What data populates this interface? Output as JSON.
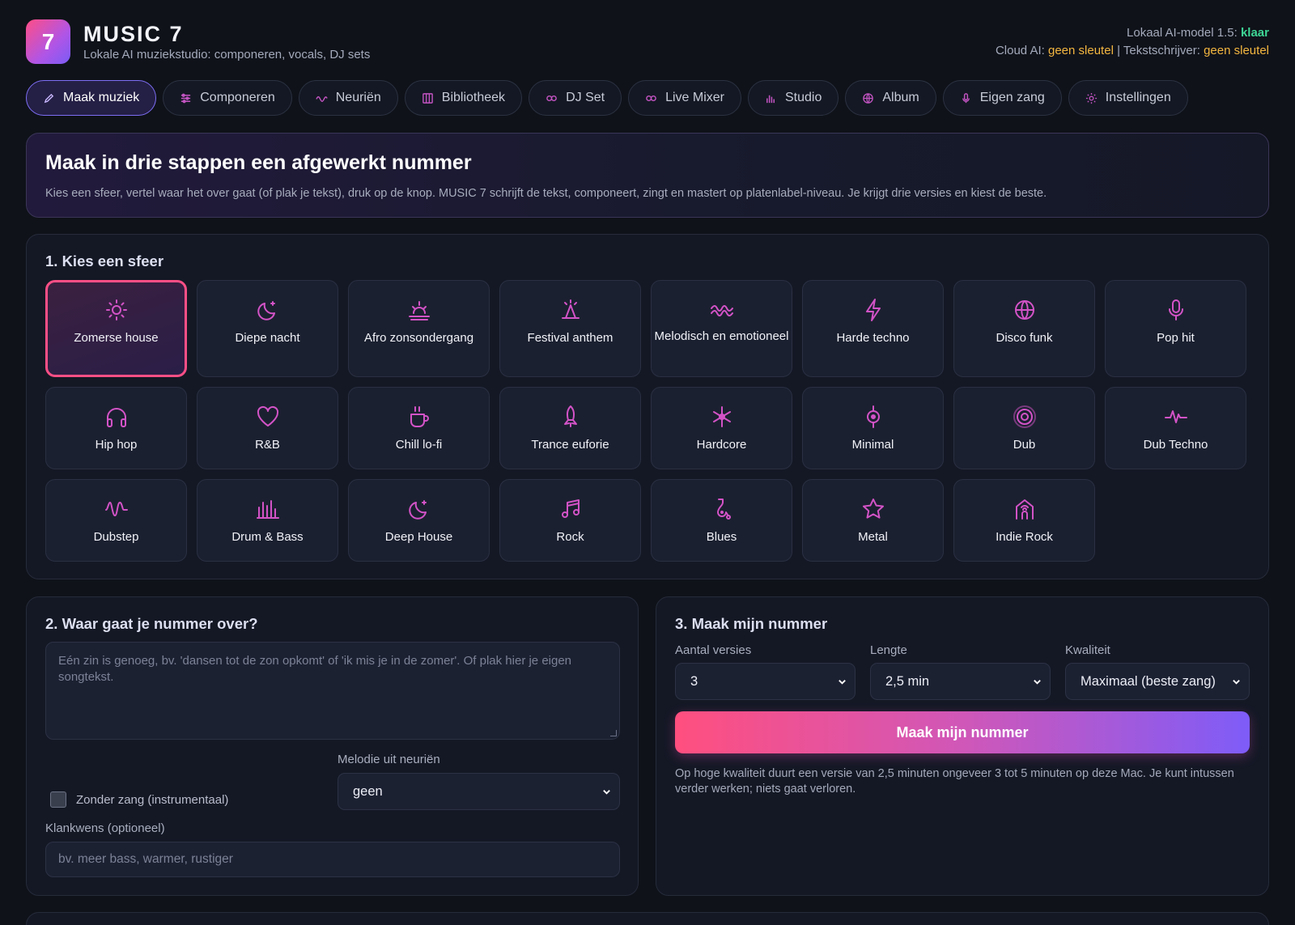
{
  "app": {
    "logo_text": "7",
    "title": "MUSIC 7",
    "subtitle": "Lokale AI muziekstudio: componeren, vocals, DJ sets"
  },
  "status": {
    "local_label": "Lokaal AI-model 1.5:",
    "local_value": "klaar",
    "cloud_label": "Cloud AI:",
    "cloud_value": "geen sleutel",
    "separator": "|",
    "writer_label": "Tekstschrijver:",
    "writer_value": "geen sleutel",
    "ok_color": "#3ed695",
    "warn_color": "#f4b740"
  },
  "tabs": [
    {
      "label": "Maak muziek",
      "icon": "pencil-icon",
      "active": true
    },
    {
      "label": "Componeren",
      "icon": "sliders-icon",
      "active": false
    },
    {
      "label": "Neuriën",
      "icon": "wave-icon",
      "active": false
    },
    {
      "label": "Bibliotheek",
      "icon": "library-icon",
      "active": false
    },
    {
      "label": "DJ Set",
      "icon": "link-icon",
      "active": false
    },
    {
      "label": "Live Mixer",
      "icon": "link-icon",
      "active": false
    },
    {
      "label": "Studio",
      "icon": "bars-icon",
      "active": false
    },
    {
      "label": "Album",
      "icon": "globe-icon",
      "active": false
    },
    {
      "label": "Eigen zang",
      "icon": "mic-icon",
      "active": false
    },
    {
      "label": "Instellingen",
      "icon": "gear-icon",
      "active": false
    }
  ],
  "intro": {
    "title": "Maak in drie stappen een afgewerkt nummer",
    "text": "Kies een sfeer, vertel waar het over gaat (of plak je tekst), druk op de knop. MUSIC 7 schrijft de tekst, componeert, zingt en mastert op platenlabel-niveau. Je krijgt drie versies en kiest de beste."
  },
  "moods": {
    "heading": "1. Kies een sfeer",
    "accent": "#d353c7",
    "selected_border": "#ff4f86",
    "items": [
      {
        "label": "Zomerse house",
        "icon": "sun-icon",
        "selected": true
      },
      {
        "label": "Diepe nacht",
        "icon": "moon-icon",
        "selected": false
      },
      {
        "label": "Afro zonsondergang",
        "icon": "sunset-icon",
        "selected": false
      },
      {
        "label": "Festival anthem",
        "icon": "festival-icon",
        "selected": false
      },
      {
        "label": "Melodisch en emotioneel",
        "icon": "waves-icon",
        "selected": false
      },
      {
        "label": "Harde techno",
        "icon": "bolt-icon",
        "selected": false
      },
      {
        "label": "Disco funk",
        "icon": "globe-icon",
        "selected": false
      },
      {
        "label": "Pop hit",
        "icon": "microphone-icon",
        "selected": false
      },
      {
        "label": "Hip hop",
        "icon": "headphones-icon",
        "selected": false
      },
      {
        "label": "R&B",
        "icon": "heart-icon",
        "selected": false
      },
      {
        "label": "Chill lo-fi",
        "icon": "coffee-icon",
        "selected": false
      },
      {
        "label": "Trance euforie",
        "icon": "rocket-icon",
        "selected": false
      },
      {
        "label": "Hardcore",
        "icon": "burst-icon",
        "selected": false
      },
      {
        "label": "Minimal",
        "icon": "dot-line-icon",
        "selected": false
      },
      {
        "label": "Dub",
        "icon": "target-icon",
        "selected": false
      },
      {
        "label": "Dub Techno",
        "icon": "pulse-icon",
        "selected": false
      },
      {
        "label": "Dubstep",
        "icon": "wobble-icon",
        "selected": false
      },
      {
        "label": "Drum & Bass",
        "icon": "eq-bars-icon",
        "selected": false
      },
      {
        "label": "Deep House",
        "icon": "moon-icon",
        "selected": false
      },
      {
        "label": "Rock",
        "icon": "music-note-icon",
        "selected": false
      },
      {
        "label": "Blues",
        "icon": "saxophone-icon",
        "selected": false
      },
      {
        "label": "Metal",
        "icon": "star-icon",
        "selected": false
      },
      {
        "label": "Indie Rock",
        "icon": "house-signal-icon",
        "selected": false
      }
    ]
  },
  "about": {
    "heading": "2. Waar gaat je nummer over?",
    "textarea_placeholder": "Eén zin is genoeg, bv. 'dansen tot de zon opkomt' of 'ik mis je in de zomer'. Of plak hier je eigen songtekst.",
    "instrumental_label": "Zonder zang (instrumentaal)",
    "instrumental_checked": false,
    "melody_label": "Melodie uit neuriën",
    "melody_value": "geen",
    "sound_label": "Klankwens (optioneel)",
    "sound_placeholder": "bv. meer bass, warmer, rustiger"
  },
  "make": {
    "heading": "3. Maak mijn nummer",
    "versions_label": "Aantal versies",
    "versions_value": "3",
    "length_label": "Lengte",
    "length_value": "2,5 min",
    "quality_label": "Kwaliteit",
    "quality_value": "Maximaal (beste zang)",
    "button_label": "Maak mijn nummer",
    "note": "Op hoge kwaliteit duurt een versie van 2,5 minuten ongeveer 3 tot 5 minuten op deze Mac. Je kunt intussen verder werken; niets gaat verloren."
  }
}
